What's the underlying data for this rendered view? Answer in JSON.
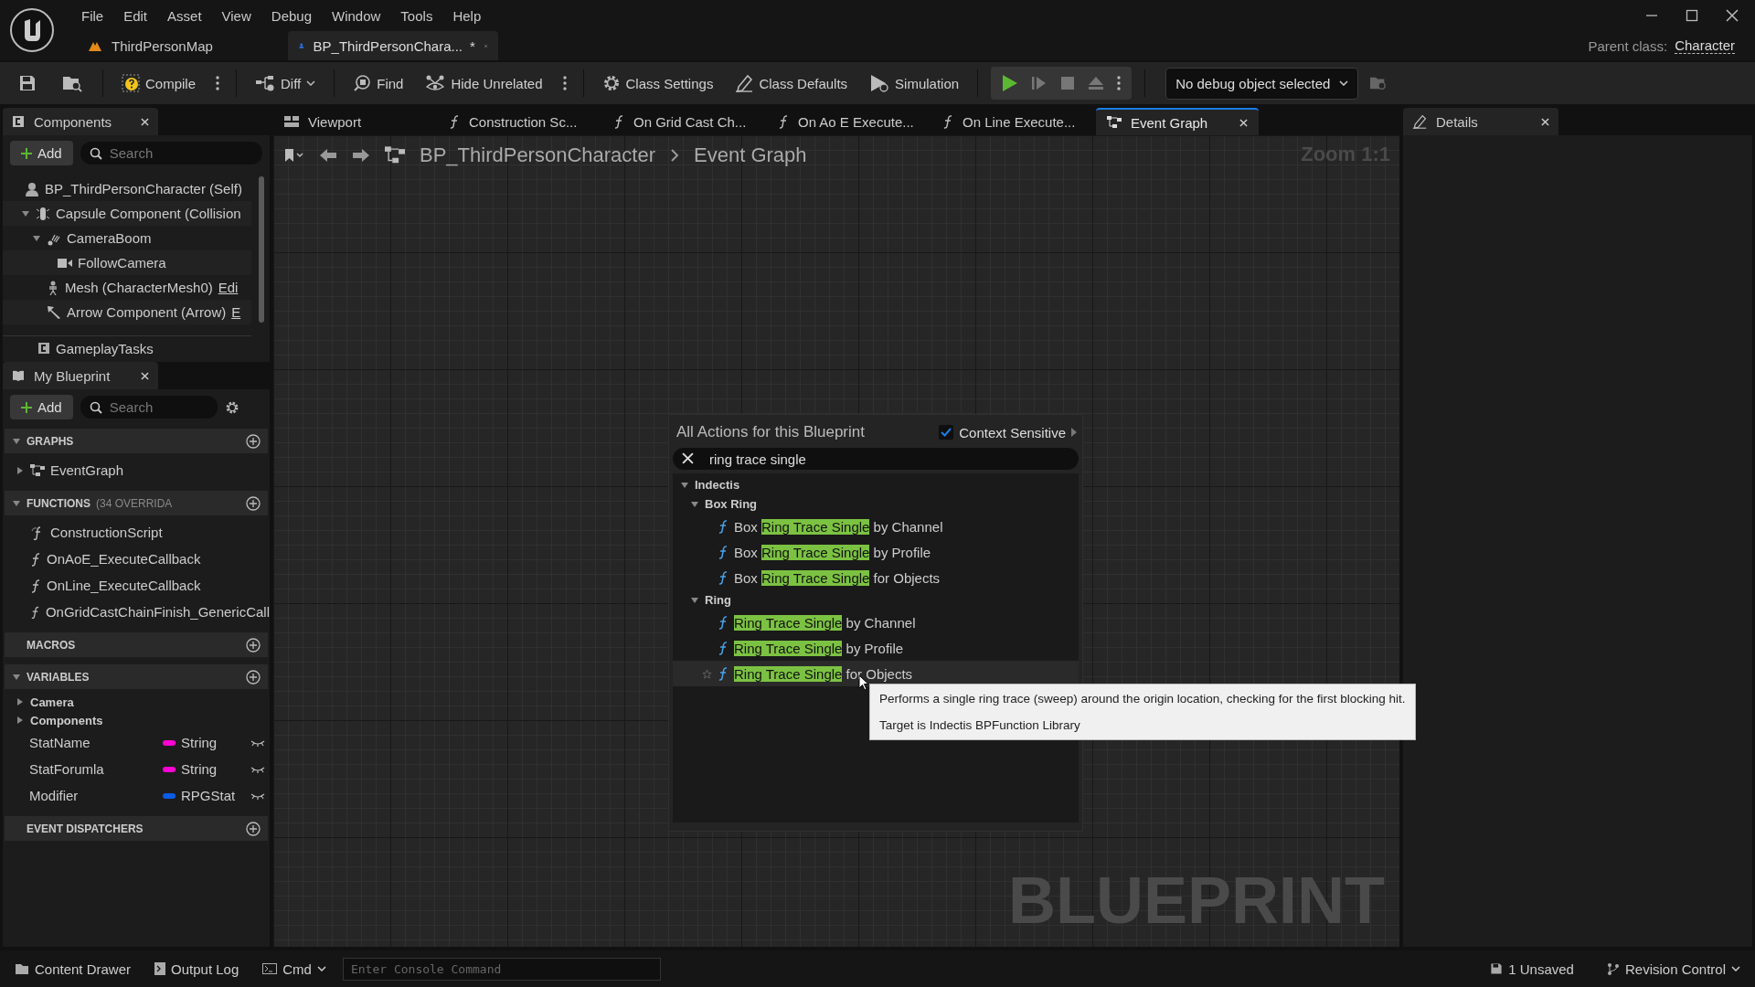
{
  "menu": [
    "File",
    "Edit",
    "Asset",
    "View",
    "Debug",
    "Window",
    "Tools",
    "Help"
  ],
  "doc_tabs": [
    {
      "label": "ThirdPersonMap",
      "kind": "map",
      "selected": false
    },
    {
      "label": "BP_ThirdPersonChara...",
      "kind": "blueprint",
      "selected": true,
      "unsaved_mark": "*"
    }
  ],
  "parent_class": {
    "label": "Parent class:",
    "value": "Character"
  },
  "toolbar": [
    {
      "kind": "save"
    },
    {
      "kind": "browse"
    },
    {
      "kind": "compile",
      "label": "Compile"
    },
    {
      "kind": "more"
    },
    {
      "kind": "diff",
      "label": "Diff"
    },
    {
      "kind": "find",
      "label": "Find"
    },
    {
      "kind": "hide",
      "label": "Hide Unrelated"
    },
    {
      "kind": "more"
    },
    {
      "kind": "settings",
      "label": "Class Settings"
    },
    {
      "kind": "defaults",
      "label": "Class Defaults"
    },
    {
      "kind": "simulation",
      "label": "Simulation"
    }
  ],
  "debug_object": {
    "value": "No debug object selected"
  },
  "components_panel": {
    "title": "Components",
    "add": "Add",
    "search_placeholder": "Search",
    "tree": [
      {
        "label": "BP_ThirdPersonCharacter (Self)",
        "kind": "actor",
        "children": [
          {
            "label": "Capsule Component (Collision",
            "kind": "capsule",
            "expanded": true,
            "children": [
              {
                "label": "CameraBoom",
                "kind": "spring_arm",
                "expanded": true,
                "children": [
                  {
                    "label": "FollowCamera",
                    "kind": "camera"
                  }
                ]
              },
              {
                "label": "Mesh (CharacterMesh0)",
                "kind": "skeletal_mesh",
                "link": "Edi"
              },
              {
                "label": "Arrow Component (Arrow)",
                "kind": "arrow",
                "link": "E"
              }
            ]
          }
        ]
      }
    ],
    "extra": [
      {
        "label": "GameplayTasks"
      }
    ]
  },
  "graph_tabs": [
    {
      "label": "Viewport",
      "kind": "viewport",
      "selected": false
    },
    {
      "label": "Construction Sc...",
      "kind": "function",
      "selected": false
    },
    {
      "label": "On Grid Cast Ch...",
      "kind": "function",
      "selected": false
    },
    {
      "label": "On Ao E Execute...",
      "kind": "function",
      "selected": false
    },
    {
      "label": "On Line Execute...",
      "kind": "function",
      "selected": false
    },
    {
      "label": "Event Graph",
      "kind": "graph",
      "selected": true
    }
  ],
  "breadcrumb": [
    "BP_ThirdPersonCharacter",
    "Event Graph"
  ],
  "zoom": "Zoom 1:1",
  "watermark": "BLUEPRINT",
  "details_panel": {
    "title": "Details"
  },
  "my_blueprint": {
    "title": "My Blueprint",
    "add": "Add",
    "search_placeholder": "Search",
    "sections": [
      {
        "title": "GRAPHS",
        "expanded": true,
        "items": [
          {
            "label": "EventGraph",
            "kind": "graph",
            "expanded": false
          }
        ]
      },
      {
        "title": "FUNCTIONS",
        "note": "(34 OVERRIDA",
        "expanded": true,
        "items": [
          {
            "label": "ConstructionScript",
            "kind": "construction"
          },
          {
            "label": "OnAoE_ExecuteCallback",
            "kind": "function"
          },
          {
            "label": "OnLine_ExecuteCallback",
            "kind": "function"
          },
          {
            "label": "OnGridCastChainFinish_GenericCall",
            "kind": "function"
          }
        ]
      },
      {
        "title": "MACROS"
      },
      {
        "title": "VARIABLES",
        "expanded": true,
        "items": [
          {
            "label": "Camera",
            "kind": "category",
            "expanded": false
          },
          {
            "label": "Components",
            "kind": "category",
            "expanded": false
          },
          {
            "label": "StatName",
            "kind": "variable",
            "type": "String",
            "color": "#ff00d4"
          },
          {
            "label": "StatForumla",
            "kind": "variable",
            "type": "String",
            "color": "#ff00d4"
          },
          {
            "label": "Modifier",
            "kind": "variable",
            "type": "RPGStat",
            "color": "#0a5ce6"
          }
        ]
      },
      {
        "title": "EVENT DISPATCHERS"
      }
    ]
  },
  "action_menu": {
    "title": "All Actions for this Blueprint",
    "context_sensitive": {
      "label": "Context Sensitive",
      "checked": true
    },
    "search": {
      "value": "ring trace single"
    },
    "tree": [
      {
        "label": "Indectis",
        "expanded": true,
        "children": [
          {
            "label": "Box Ring",
            "expanded": true,
            "children": [
              {
                "kind": "function",
                "before": "Box ",
                "match": "Ring Trace Single",
                "after": " by Channel",
                "hovered": false
              },
              {
                "kind": "function",
                "before": "Box ",
                "match": "Ring Trace Single",
                "after": " by Profile",
                "hovered": false
              },
              {
                "kind": "function",
                "before": "Box ",
                "match": "Ring Trace Single",
                "after": " for Objects",
                "hovered": false
              }
            ]
          },
          {
            "label": "Ring",
            "expanded": true,
            "children": [
              {
                "kind": "function",
                "match": "Ring Trace Single",
                "after": " by Channel",
                "hovered": false
              },
              {
                "kind": "function",
                "match": "Ring Trace Single",
                "after": " by Profile",
                "hovered": false
              },
              {
                "kind": "function",
                "match": "Ring Trace Single",
                "after": " for Objects",
                "hovered": true
              }
            ]
          }
        ]
      }
    ]
  },
  "tooltip": {
    "lines": [
      "Performs a single ring trace (sweep) around the origin location, checking for the first blocking hit.",
      "Target is Indectis BPFunction Library"
    ]
  },
  "bottom_bar": {
    "content_drawer": "Content Drawer",
    "output_log": "Output Log",
    "cmd": "Cmd",
    "console_placeholder": "Enter Console Command",
    "unsaved": "1 Unsaved",
    "revision_control": "Revision Control"
  }
}
